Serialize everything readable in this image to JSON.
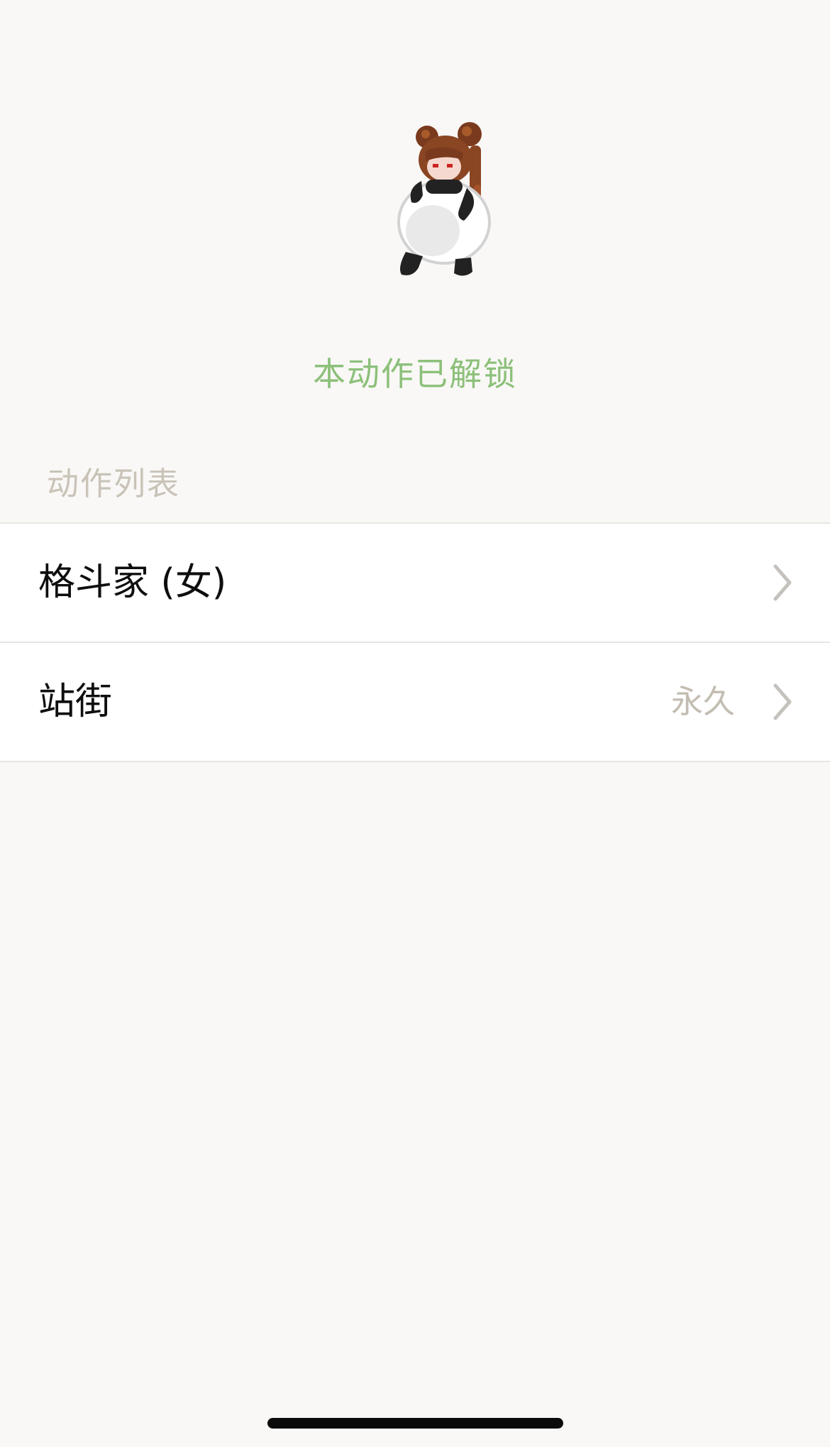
{
  "status": {
    "unlocked_text": "本动作已解锁"
  },
  "section": {
    "title": "动作列表"
  },
  "list": {
    "items": [
      {
        "label": "格斗家 (女)",
        "detail": ""
      },
      {
        "label": "站街",
        "detail": "永久"
      }
    ]
  },
  "colors": {
    "accent_green": "#8cc07a",
    "background": "#f9f8f6",
    "muted_text": "#c9c3b8"
  },
  "icons": {
    "sprite": "female-fighter-panda-costume-sprite",
    "chevron": "chevron-right-icon"
  }
}
